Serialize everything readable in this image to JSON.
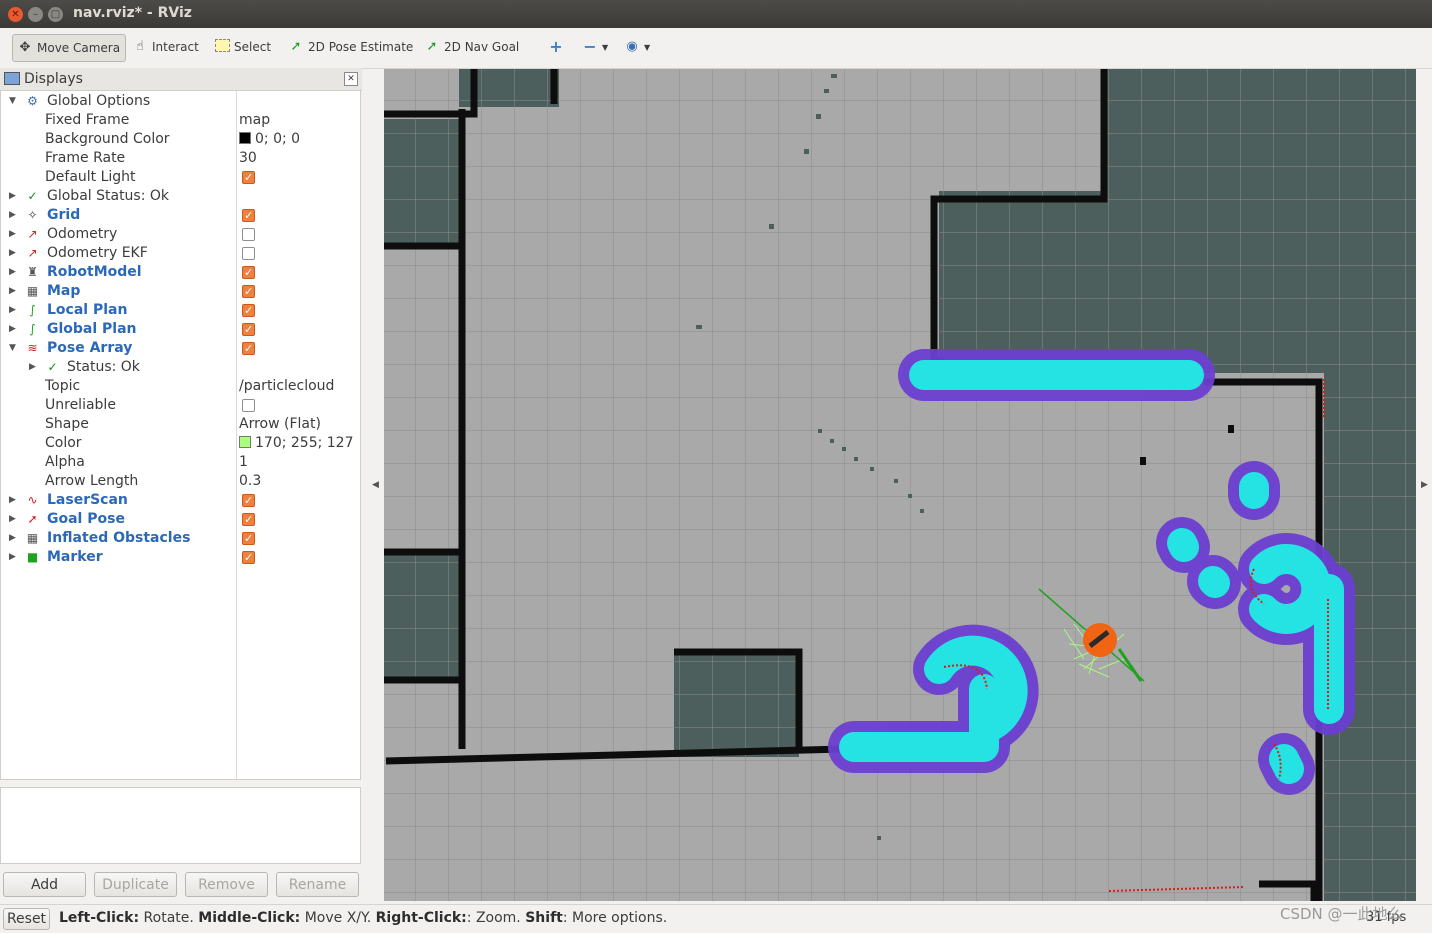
{
  "window": {
    "title": "nav.rviz* - RViz"
  },
  "toolbar": {
    "tools": [
      {
        "label": "Move Camera",
        "icon": "move-camera-icon"
      },
      {
        "label": "Interact",
        "icon": "hand-icon"
      },
      {
        "label": "Select",
        "icon": "select-box-icon"
      },
      {
        "label": "2D Pose Estimate",
        "icon": "green-arrow-icon"
      },
      {
        "label": "2D Nav Goal",
        "icon": "green-arrow-icon"
      }
    ],
    "icons": [
      "plus-icon",
      "minus-icon",
      "eye-icon"
    ]
  },
  "displays": {
    "title": "Displays",
    "rows": [
      {
        "name": "Global Options",
        "value": "",
        "expander": "open",
        "icon": "gear-icon"
      },
      {
        "name": "Fixed Frame",
        "value": "map"
      },
      {
        "name": "Background Color",
        "value": "0; 0; 0",
        "swatch": "#000000"
      },
      {
        "name": "Frame Rate",
        "value": "30"
      },
      {
        "name": "Default Light",
        "checked": true
      },
      {
        "name": "Global Status: Ok",
        "expander": "closed",
        "icon": "check-icon"
      },
      {
        "name": "Grid",
        "checked": true,
        "expander": "closed",
        "icon": "grid-icon",
        "blue": true
      },
      {
        "name": "Odometry",
        "checked": false,
        "expander": "closed",
        "icon": "odometry-icon"
      },
      {
        "name": "Odometry EKF",
        "checked": false,
        "expander": "closed",
        "icon": "odometry-icon"
      },
      {
        "name": "RobotModel",
        "checked": true,
        "expander": "closed",
        "icon": "robot-icon",
        "blue": true
      },
      {
        "name": "Map",
        "checked": true,
        "expander": "closed",
        "icon": "map-icon",
        "blue": true
      },
      {
        "name": "Local Plan",
        "checked": true,
        "expander": "closed",
        "icon": "path-icon",
        "blue": true
      },
      {
        "name": "Global Plan",
        "checked": true,
        "expander": "closed",
        "icon": "path-icon",
        "blue": true
      },
      {
        "name": "Pose Array",
        "checked": true,
        "expander": "open",
        "icon": "pose-array-icon",
        "blue": true
      },
      {
        "name": "Status: Ok",
        "expander": "closed",
        "icon": "check-icon",
        "indent": 2
      },
      {
        "name": "Topic",
        "value": "/particlecloud"
      },
      {
        "name": "Unreliable",
        "checked": false
      },
      {
        "name": "Shape",
        "value": "Arrow (Flat)"
      },
      {
        "name": "Color",
        "value": "170; 255; 127",
        "swatch": "#aaff7f"
      },
      {
        "name": "Alpha",
        "value": "1"
      },
      {
        "name": "Arrow Length",
        "value": "0.3"
      },
      {
        "name": "LaserScan",
        "checked": true,
        "expander": "closed",
        "icon": "laser-icon",
        "blue": true
      },
      {
        "name": "Goal Pose",
        "checked": true,
        "expander": "closed",
        "icon": "goal-icon",
        "blue": true
      },
      {
        "name": "Inflated Obstacles",
        "checked": true,
        "expander": "closed",
        "icon": "map-icon",
        "blue": true
      },
      {
        "name": "Marker",
        "checked": true,
        "expander": "closed",
        "icon": "cube-icon",
        "blue": true
      }
    ]
  },
  "buttons": {
    "add": "Add",
    "duplicate": "Duplicate",
    "remove": "Remove",
    "rename": "Rename"
  },
  "status": {
    "reset": "Reset",
    "help": [
      {
        "b": "Left-Click:",
        "t": " Rotate. "
      },
      {
        "b": "Middle-Click:",
        "t": " Move X/Y. "
      },
      {
        "b": "Right-Click:",
        "t": ": Zoom. "
      },
      {
        "b": "Shift",
        "t": ": More options."
      }
    ],
    "fps": "31 fps"
  },
  "watermark": "CSDN @一此地么",
  "colors": {
    "accent": "#f08040",
    "blue_label": "#2b69b8",
    "map_free": "#a9a9a9",
    "map_unknown": "#4c5f5c",
    "inflation": "#25e3e3"
  }
}
